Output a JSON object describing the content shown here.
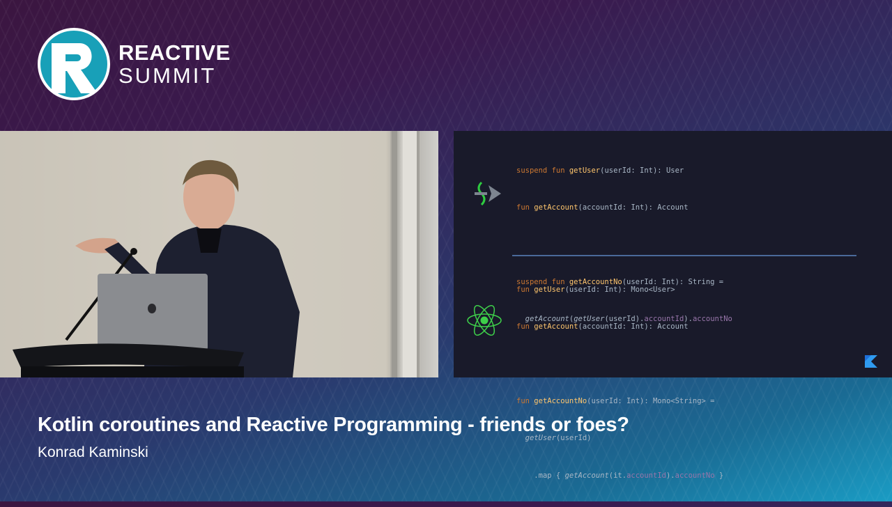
{
  "brand": {
    "line1": "REACTIVE",
    "line2": "SUMMIT"
  },
  "video": {
    "laptop_logo": ""
  },
  "slide": {
    "block1": {
      "l1": {
        "kw": "suspend fun ",
        "fn": "getUser",
        "rest": "(userId: Int): User"
      },
      "l2": {
        "kw": "fun ",
        "fn": "getAccount",
        "rest": "(accountId: Int): Account"
      },
      "l3": {
        "kw": "suspend fun ",
        "fn": "getAccountNo",
        "rest": "(userId: Int): String ="
      },
      "l4": {
        "call1": "getAccount",
        "p1": "(",
        "call2": "getUser",
        "p2": "(userId).",
        "prop1": "accountId",
        "p3": ").",
        "prop2": "accountNo"
      }
    },
    "block2": {
      "l1": {
        "kw": "fun ",
        "fn": "getUser",
        "rest": "(userId: Int): Mono<User>"
      },
      "l2": {
        "kw": "fun ",
        "fn": "getAccount",
        "rest": "(accountId: Int): Account"
      },
      "l3": {
        "kw": "fun ",
        "fn": "getAccountNo",
        "rest": "(userId: Int): Mono<String> ="
      },
      "l4": {
        "call": "getUser",
        "rest": "(userId)"
      },
      "l5": {
        "pre": ".map { ",
        "call": "getAccount",
        "p1": "(it.",
        "prop1": "accountId",
        "p2": ").",
        "prop2": "accountNo",
        "post": " }"
      }
    },
    "icons": {
      "top": "coroutines-icon",
      "bottom": "reactor-icon",
      "corner": "kotlin-icon"
    }
  },
  "talk": {
    "title": "Kotlin coroutines and Reactive Programming - friends or foes?",
    "speaker": "Konrad Kaminski"
  }
}
